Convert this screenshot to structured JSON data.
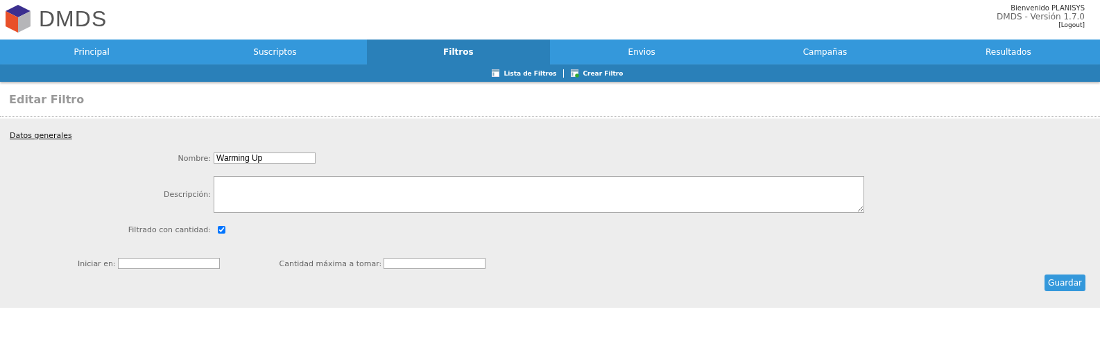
{
  "header": {
    "logo_text": "DMDS",
    "welcome": "Bienvenido PLANISYS",
    "version": "DMDS - Versión 1.7.0",
    "logout": "[Logout]"
  },
  "tabs": [
    {
      "label": "Principal",
      "selected": false
    },
    {
      "label": "Suscriptos",
      "selected": false
    },
    {
      "label": "Filtros",
      "selected": true
    },
    {
      "label": "Envios",
      "selected": false
    },
    {
      "label": "Campañas",
      "selected": false
    },
    {
      "label": "Resultados",
      "selected": false
    }
  ],
  "subnav": [
    {
      "label": "Lista de Filtros",
      "kind": "list"
    },
    {
      "label": "Crear Filtro",
      "kind": "create"
    }
  ],
  "page_title": "Editar Filtro",
  "section_title": "Datos generales",
  "form": {
    "nombre": {
      "label": "Nombre:",
      "value": "Warming Up"
    },
    "descripcion": {
      "label": "Descripción:"
    },
    "filtrado": {
      "label": "Filtrado con cantidad:",
      "checked": true
    },
    "iniciar": {
      "label": "Iniciar en:"
    },
    "cantidad": {
      "label": "Cantidad máxima a tomar:"
    }
  },
  "save_button": "Guardar"
}
